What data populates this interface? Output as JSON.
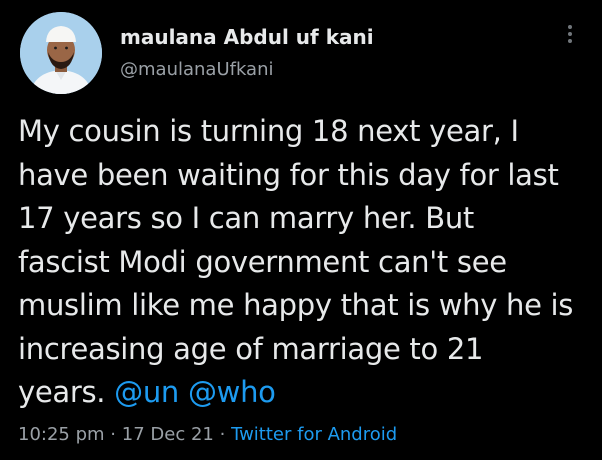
{
  "author": {
    "display_name": "maulana Abdul uf kani",
    "handle": "@maulanaUfkani"
  },
  "tweet": {
    "lines": [
      "My cousin is turning 18 next year, I",
      "have been waiting for this day for last",
      "17 years so I can marry her. But",
      "fascist Modi government can't see",
      "muslim like me happy that is why he is",
      "increasing age of marriage to 21"
    ],
    "last_line_text": "years.",
    "mentions": [
      "@un",
      "@who"
    ]
  },
  "meta": {
    "time": "10:25 pm",
    "separator": "·",
    "date": "17 Dec 21",
    "source": "Twitter for Android"
  },
  "colors": {
    "background": "#000000",
    "text": "#e7e9ea",
    "secondary": "#9aa0a6",
    "link": "#1d9bf0"
  },
  "icons": {
    "more": "more-vertical-icon",
    "avatar": "profile-photo"
  }
}
